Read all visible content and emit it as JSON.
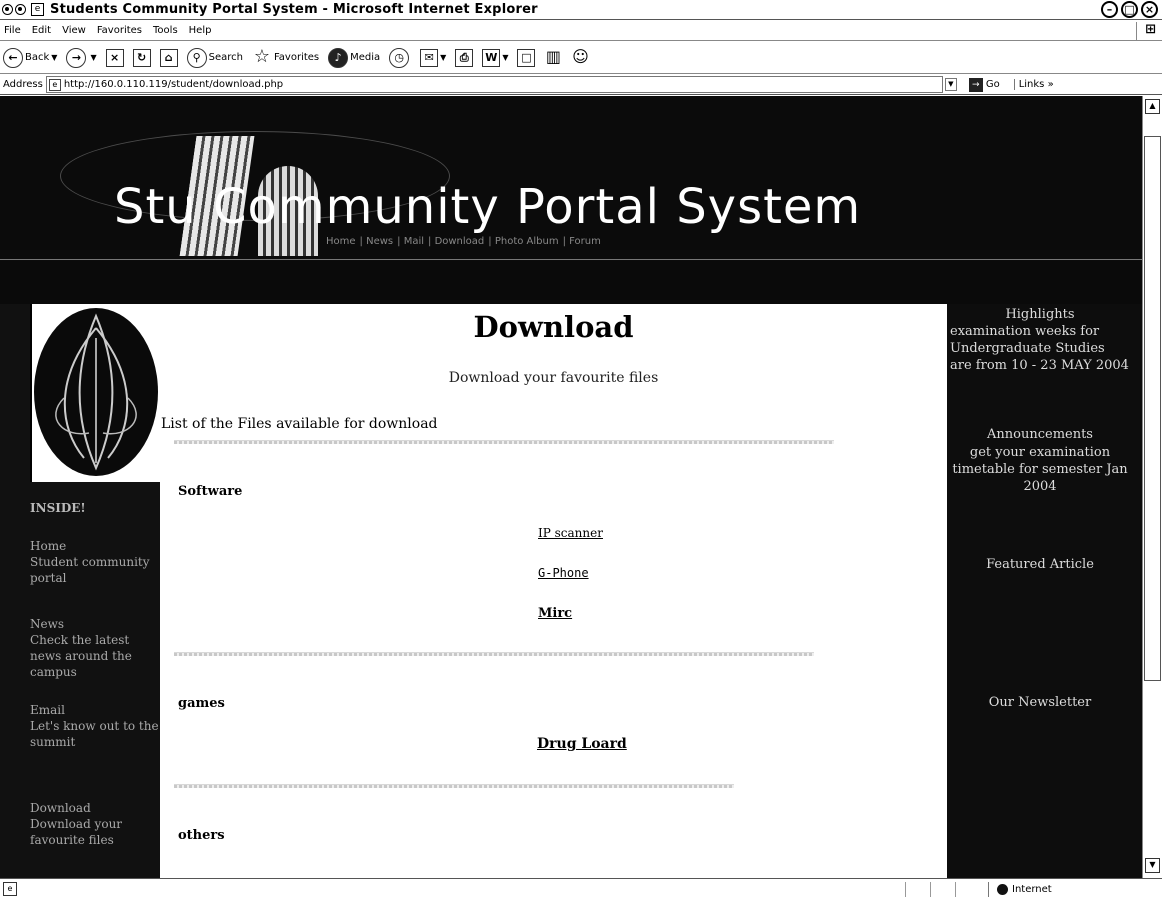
{
  "window": {
    "title": "Students Community Portal System - Microsoft Internet Explorer",
    "controls": [
      "–",
      "□",
      "×"
    ]
  },
  "menu": [
    "File",
    "Edit",
    "View",
    "Favorites",
    "Tools",
    "Help"
  ],
  "toolbar": {
    "back": "Back",
    "search": "Search",
    "favorites": "Favorites",
    "media": "Media"
  },
  "address": {
    "label": "Address",
    "url": "http://160.0.110.119/student/download.php",
    "go": "Go",
    "links": "Links »"
  },
  "banner": {
    "title": "Stu            Community Portal System",
    "nav": [
      "Home",
      "News",
      "Mail",
      "Download",
      "Photo Album",
      "Forum"
    ]
  },
  "left": {
    "heading": "INSIDE!",
    "items": [
      {
        "title": "Home",
        "desc": "Student community portal"
      },
      {
        "title": "News",
        "desc": "Check the latest news around the campus"
      },
      {
        "title": "Email",
        "desc": "Let's know out to the summit"
      },
      {
        "title": "Download",
        "desc": "Download your favourite files"
      }
    ]
  },
  "main": {
    "title": "Download",
    "subtitle": "Download your favourite files",
    "list_heading": "List of the Files available for download",
    "sections": [
      {
        "heading": "Software",
        "files": [
          "IP scanner",
          "G-Phone",
          "Mirc"
        ]
      },
      {
        "heading": "games",
        "files": [
          "Drug Loard"
        ]
      },
      {
        "heading": "others",
        "files": []
      }
    ]
  },
  "right": {
    "highlights_heading": "Highlights",
    "highlights_text": "examination weeks for Undergraduate Studies are from 10 - 23 MAY 2004",
    "announcements_heading": "Announcements",
    "announcements_text": "get your examination timetable for semester Jan 2004",
    "featured_heading": "Featured Article",
    "newsletter_heading": "Our Newsletter"
  },
  "status": {
    "zone": "Internet"
  }
}
